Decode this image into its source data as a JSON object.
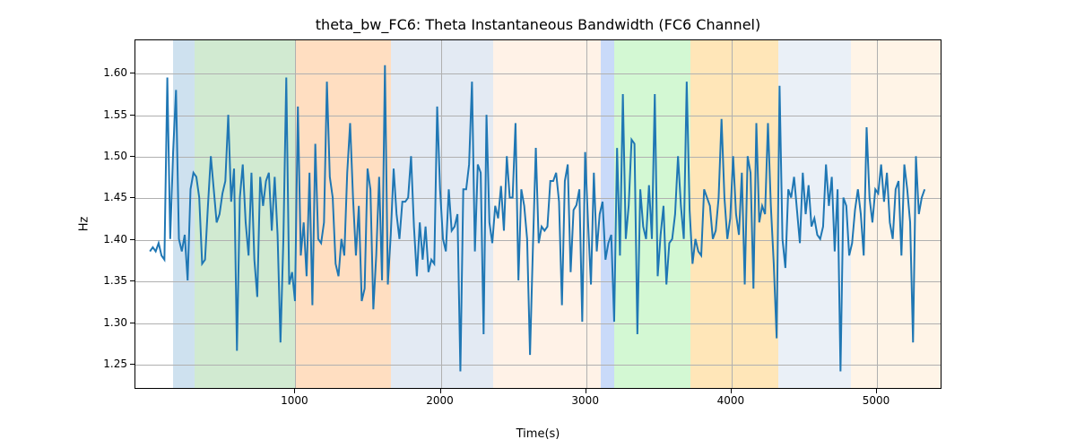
{
  "chart_data": {
    "type": "line",
    "title": "theta_bw_FC6: Theta Instantaneous Bandwidth (FC6 Channel)",
    "xlabel": "Time(s)",
    "ylabel": "Hz",
    "xlim": [
      -100,
      5450
    ],
    "ylim": [
      1.22,
      1.64
    ],
    "x_ticks": [
      1000,
      2000,
      3000,
      4000,
      5000
    ],
    "y_ticks": [
      1.25,
      1.3,
      1.35,
      1.4,
      1.45,
      1.5,
      1.55,
      1.6
    ],
    "x": [
      0,
      20,
      40,
      60,
      80,
      100,
      120,
      140,
      160,
      180,
      200,
      220,
      240,
      260,
      280,
      300,
      320,
      340,
      360,
      380,
      400,
      420,
      440,
      460,
      480,
      500,
      520,
      540,
      560,
      580,
      600,
      620,
      640,
      660,
      680,
      700,
      720,
      740,
      760,
      780,
      800,
      820,
      840,
      860,
      880,
      900,
      920,
      940,
      960,
      980,
      1000,
      1020,
      1040,
      1060,
      1080,
      1100,
      1120,
      1140,
      1160,
      1180,
      1200,
      1220,
      1240,
      1260,
      1280,
      1300,
      1320,
      1340,
      1360,
      1380,
      1400,
      1420,
      1440,
      1460,
      1480,
      1500,
      1520,
      1540,
      1560,
      1580,
      1600,
      1620,
      1640,
      1660,
      1680,
      1700,
      1720,
      1740,
      1760,
      1780,
      1800,
      1820,
      1840,
      1860,
      1880,
      1900,
      1920,
      1940,
      1960,
      1980,
      2000,
      2020,
      2040,
      2060,
      2080,
      2100,
      2120,
      2140,
      2160,
      2180,
      2200,
      2220,
      2240,
      2260,
      2280,
      2300,
      2320,
      2340,
      2360,
      2380,
      2400,
      2420,
      2440,
      2460,
      2480,
      2500,
      2520,
      2540,
      2560,
      2580,
      2600,
      2620,
      2640,
      2660,
      2680,
      2700,
      2720,
      2740,
      2760,
      2780,
      2800,
      2820,
      2840,
      2860,
      2880,
      2900,
      2920,
      2940,
      2960,
      2980,
      3000,
      3020,
      3040,
      3060,
      3080,
      3100,
      3120,
      3140,
      3160,
      3180,
      3200,
      3220,
      3240,
      3260,
      3280,
      3300,
      3320,
      3340,
      3360,
      3380,
      3400,
      3420,
      3440,
      3460,
      3480,
      3500,
      3520,
      3540,
      3560,
      3580,
      3600,
      3620,
      3640,
      3660,
      3680,
      3700,
      3720,
      3740,
      3760,
      3780,
      3800,
      3820,
      3840,
      3860,
      3880,
      3900,
      3920,
      3940,
      3960,
      3980,
      4000,
      4020,
      4040,
      4060,
      4080,
      4100,
      4120,
      4140,
      4160,
      4180,
      4200,
      4220,
      4240,
      4260,
      4280,
      4300,
      4320,
      4340,
      4360,
      4380,
      4400,
      4420,
      4440,
      4460,
      4480,
      4500,
      4520,
      4540,
      4560,
      4580,
      4600,
      4620,
      4640,
      4660,
      4680,
      4700,
      4720,
      4740,
      4760,
      4780,
      4800,
      4820,
      4840,
      4860,
      4880,
      4900,
      4920,
      4940,
      4960,
      4980,
      5000,
      5020,
      5040,
      5060,
      5080,
      5100,
      5120,
      5140,
      5160,
      5180,
      5200,
      5220,
      5240,
      5260,
      5280,
      5300,
      5320,
      5340
    ],
    "values": [
      1.385,
      1.39,
      1.385,
      1.395,
      1.38,
      1.375,
      1.595,
      1.4,
      1.505,
      1.58,
      1.4,
      1.385,
      1.405,
      1.35,
      1.46,
      1.48,
      1.475,
      1.45,
      1.37,
      1.375,
      1.44,
      1.5,
      1.46,
      1.42,
      1.43,
      1.455,
      1.47,
      1.55,
      1.445,
      1.485,
      1.265,
      1.45,
      1.49,
      1.42,
      1.38,
      1.48,
      1.375,
      1.33,
      1.475,
      1.44,
      1.47,
      1.48,
      1.41,
      1.475,
      1.405,
      1.275,
      1.4,
      1.595,
      1.345,
      1.36,
      1.325,
      1.56,
      1.38,
      1.42,
      1.355,
      1.48,
      1.32,
      1.515,
      1.4,
      1.395,
      1.42,
      1.59,
      1.475,
      1.45,
      1.37,
      1.355,
      1.4,
      1.38,
      1.48,
      1.54,
      1.45,
      1.38,
      1.44,
      1.325,
      1.34,
      1.485,
      1.46,
      1.315,
      1.38,
      1.475,
      1.35,
      1.61,
      1.345,
      1.405,
      1.485,
      1.43,
      1.4,
      1.445,
      1.445,
      1.45,
      1.5,
      1.415,
      1.355,
      1.42,
      1.375,
      1.415,
      1.36,
      1.375,
      1.37,
      1.56,
      1.46,
      1.4,
      1.385,
      1.46,
      1.41,
      1.415,
      1.43,
      1.24,
      1.46,
      1.46,
      1.49,
      1.59,
      1.385,
      1.49,
      1.48,
      1.285,
      1.55,
      1.42,
      1.395,
      1.44,
      1.425,
      1.464,
      1.41,
      1.5,
      1.45,
      1.45,
      1.54,
      1.35,
      1.46,
      1.44,
      1.4,
      1.26,
      1.39,
      1.51,
      1.395,
      1.415,
      1.41,
      1.415,
      1.47,
      1.47,
      1.48,
      1.445,
      1.32,
      1.47,
      1.49,
      1.36,
      1.435,
      1.441,
      1.46,
      1.3,
      1.505,
      1.42,
      1.345,
      1.48,
      1.385,
      1.43,
      1.445,
      1.375,
      1.395,
      1.405,
      1.3,
      1.51,
      1.38,
      1.575,
      1.4,
      1.44,
      1.52,
      1.515,
      1.285,
      1.46,
      1.415,
      1.4,
      1.465,
      1.4,
      1.575,
      1.355,
      1.405,
      1.44,
      1.345,
      1.395,
      1.4,
      1.43,
      1.5,
      1.44,
      1.4,
      1.59,
      1.435,
      1.37,
      1.4,
      1.385,
      1.38,
      1.46,
      1.45,
      1.44,
      1.4,
      1.41,
      1.45,
      1.545,
      1.45,
      1.4,
      1.425,
      1.5,
      1.43,
      1.405,
      1.48,
      1.345,
      1.5,
      1.48,
      1.34,
      1.54,
      1.42,
      1.44,
      1.43,
      1.54,
      1.44,
      1.37,
      1.28,
      1.585,
      1.4,
      1.365,
      1.46,
      1.45,
      1.475,
      1.435,
      1.395,
      1.48,
      1.43,
      1.465,
      1.415,
      1.425,
      1.405,
      1.4,
      1.415,
      1.49,
      1.44,
      1.475,
      1.385,
      1.46,
      1.24,
      1.45,
      1.44,
      1.38,
      1.395,
      1.435,
      1.46,
      1.43,
      1.38,
      1.535,
      1.45,
      1.42,
      1.46,
      1.455,
      1.49,
      1.445,
      1.48,
      1.42,
      1.4,
      1.46,
      1.47,
      1.38,
      1.49,
      1.46,
      1.42,
      1.275,
      1.5,
      1.43,
      1.45,
      1.46
    ],
    "bands": [
      {
        "start": 160,
        "end": 310,
        "cls": "band-blue"
      },
      {
        "start": 310,
        "end": 1000,
        "cls": "band-green"
      },
      {
        "start": 1000,
        "end": 1660,
        "cls": "band-orange"
      },
      {
        "start": 1660,
        "end": 2360,
        "cls": "band-lightblue"
      },
      {
        "start": 2360,
        "end": 3100,
        "cls": "band-peach"
      },
      {
        "start": 3100,
        "end": 3190,
        "cls": "band-blue2"
      },
      {
        "start": 3190,
        "end": 3720,
        "cls": "band-green2"
      },
      {
        "start": 3720,
        "end": 4320,
        "cls": "band-orange2"
      },
      {
        "start": 4320,
        "end": 4820,
        "cls": "band-lightblue2"
      },
      {
        "start": 4820,
        "end": 5450,
        "cls": "band-peach2"
      }
    ]
  }
}
